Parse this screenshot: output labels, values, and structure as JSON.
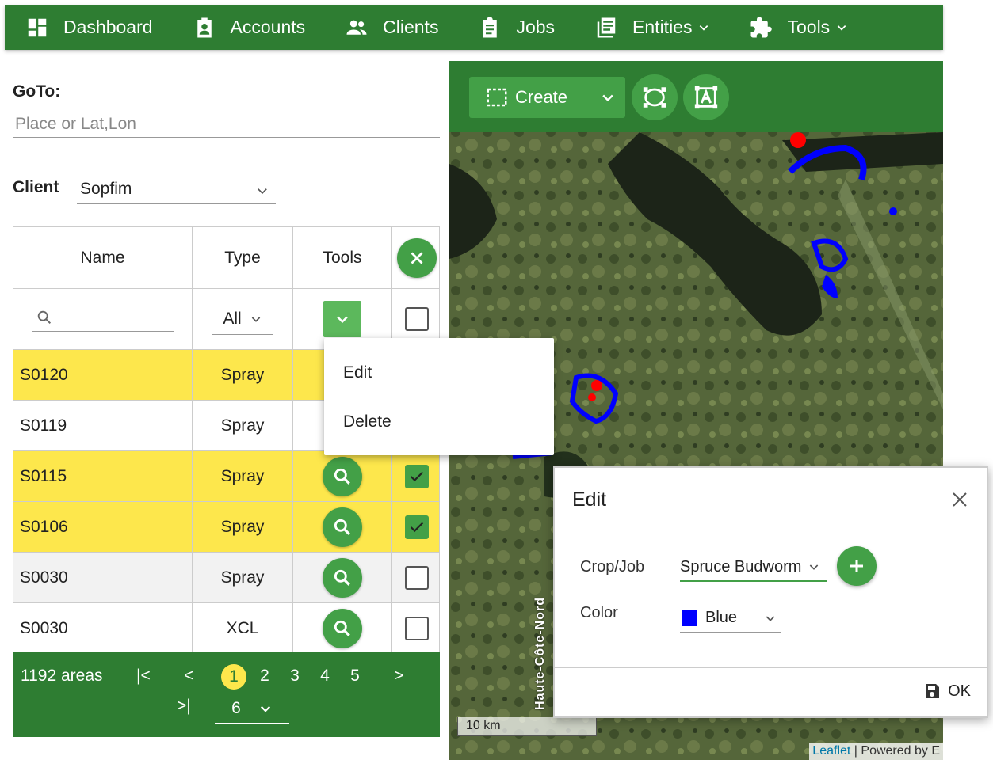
{
  "nav": {
    "items": [
      {
        "label": "Dashboard",
        "icon": "dashboard-icon"
      },
      {
        "label": "Accounts",
        "icon": "badge-icon"
      },
      {
        "label": "Clients",
        "icon": "people-icon"
      },
      {
        "label": "Jobs",
        "icon": "clipboard-icon"
      },
      {
        "label": "Entities",
        "icon": "list-icon",
        "dropdown": true
      },
      {
        "label": "Tools",
        "icon": "puzzle-icon",
        "dropdown": true
      }
    ]
  },
  "goto": {
    "label": "GoTo:",
    "placeholder": "Place or Lat,Lon"
  },
  "client": {
    "label": "Client",
    "value": "Sopfim"
  },
  "table": {
    "headers": {
      "name": "Name",
      "type": "Type",
      "tools": "Tools"
    },
    "filter": {
      "type_value": "All"
    },
    "rows": [
      {
        "name": "S0120",
        "type": "Spray",
        "highlighted": true,
        "checked": false
      },
      {
        "name": "S0119",
        "type": "Spray",
        "highlighted": false,
        "checked": false
      },
      {
        "name": "S0115",
        "type": "Spray",
        "highlighted": true,
        "checked": true
      },
      {
        "name": "S0106",
        "type": "Spray",
        "highlighted": true,
        "checked": true
      },
      {
        "name": "S0030",
        "type": "Spray",
        "highlighted": false,
        "checked": false
      },
      {
        "name": "S0030",
        "type": "XCL",
        "highlighted": false,
        "checked": false
      }
    ]
  },
  "pager": {
    "count": "1192 areas",
    "pages": [
      "1",
      "2",
      "3",
      "4",
      "5"
    ],
    "active_page": "1",
    "page_size": "6"
  },
  "context_menu": {
    "items": [
      "Edit",
      "Delete"
    ]
  },
  "map": {
    "create_label": "Create",
    "scale_label": "10 km",
    "region_label": "Haute-Côte-Nord",
    "attribution_link": "Leaflet",
    "attribution_text": " | Powered by E"
  },
  "dialog": {
    "title": "Edit",
    "crop_label": "Crop/Job",
    "crop_value": "Spruce Budworm",
    "color_label": "Color",
    "color_value": "Blue",
    "ok_label": "OK"
  },
  "colors": {
    "brand_green": "#2e7d32",
    "button_green": "#43a047",
    "highlight_yellow": "#fde74c",
    "polygon_blue": "#0000ff",
    "polygon_red": "#ff0000"
  }
}
